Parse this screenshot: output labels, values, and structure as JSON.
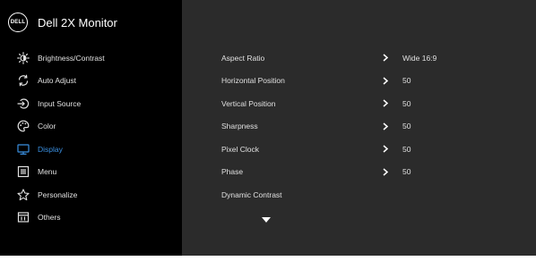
{
  "header": {
    "logo_text": "DELL",
    "title": "Dell 2X Monitor"
  },
  "colors": {
    "sidebar_bg": "#000000",
    "panel_bg": "#2b2b2b",
    "accent": "#3a8fe0",
    "text": "#e0e0e0"
  },
  "sidebar": {
    "items": [
      {
        "label": "Brightness/Contrast",
        "icon": "brightness-icon",
        "active": false
      },
      {
        "label": "Auto Adjust",
        "icon": "auto-adjust-icon",
        "active": false
      },
      {
        "label": "Input Source",
        "icon": "input-source-icon",
        "active": false
      },
      {
        "label": "Color",
        "icon": "color-icon",
        "active": false
      },
      {
        "label": "Display",
        "icon": "display-icon",
        "active": true
      },
      {
        "label": "Menu",
        "icon": "menu-icon",
        "active": false
      },
      {
        "label": "Personalize",
        "icon": "star-icon",
        "active": false
      },
      {
        "label": "Others",
        "icon": "others-icon",
        "active": false
      }
    ]
  },
  "display_settings": {
    "rows": [
      {
        "label": "Aspect Ratio",
        "value": "Wide 16:9"
      },
      {
        "label": "Horizontal Position",
        "value": "50"
      },
      {
        "label": "Vertical Position",
        "value": "50"
      },
      {
        "label": "Sharpness",
        "value": "50"
      },
      {
        "label": "Pixel Clock",
        "value": "50"
      },
      {
        "label": "Phase",
        "value": "50"
      },
      {
        "label": "Dynamic Contrast",
        "value": ""
      }
    ],
    "more_indicator": "chevron-down-icon"
  }
}
